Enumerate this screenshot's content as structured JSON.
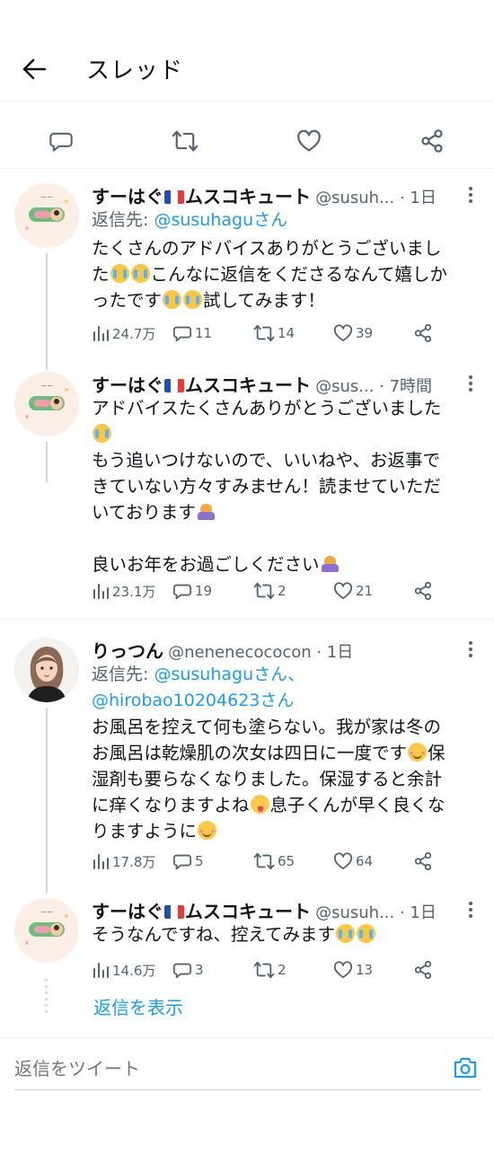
{
  "header": {
    "title": "スレッド"
  },
  "actions": [
    {
      "name": "reply-action-button",
      "icon": "reply-icon"
    },
    {
      "name": "retweet-action-button",
      "icon": "retweet-icon"
    },
    {
      "name": "like-action-button",
      "icon": "heart-icon"
    },
    {
      "name": "share-action-button",
      "icon": "share-icon"
    }
  ],
  "tweets": [
    {
      "name_before_flag": "すーはぐ",
      "name_after_flag": "ムスコキュート",
      "handle": "@susuh...",
      "time": "1日",
      "reply_prefix": "返信先: ",
      "reply_targets": [
        "@susuhaguさん"
      ],
      "text_parts": [
        "たくさんのアドバイスありがとうございまし\nた",
        "こんなに返信をくださるなんて嬉しか\nったです",
        "試してみます！"
      ],
      "metrics": {
        "views": "24.7万",
        "replies": "11",
        "retweets": "14",
        "likes": "39"
      }
    },
    {
      "name_before_flag": "すーはぐ",
      "name_after_flag": "ムスコキュート",
      "handle": "@sus...",
      "time": "7時間",
      "text_parts": [
        "アドバイスたくさんありがとうございました\n",
        "\nもう追いつけないので、いいねや、お返事で\nきていない方々すみません！読ませていただ\nいております",
        "\n\n良いお年をお過ごしください",
        ""
      ],
      "metrics": {
        "views": "23.1万",
        "replies": "19",
        "retweets": "2",
        "likes": "21"
      }
    },
    {
      "name": "りっつん",
      "handle": "@nenenecococon",
      "time": "1日",
      "reply_prefix": "返信先: ",
      "reply_targets": [
        "@susuhaguさん、",
        "@hirobao10204623さん"
      ],
      "text_parts": [
        "お風呂を控えて何も塗らない。我が家は冬の\nお風呂は乾燥肌の次女は四日に一度です",
        "保\n湿剤も要らなくなりました。保湿すると余計\nに痒くなりますよね",
        "息子くんが早く良くな\nりますように",
        ""
      ],
      "metrics": {
        "views": "17.8万",
        "replies": "5",
        "retweets": "65",
        "likes": "64"
      }
    },
    {
      "name_before_flag": "すーはぐ",
      "name_after_flag": "ムスコキュート",
      "handle": "@susuh...",
      "time": "1日",
      "text_parts": [
        "そうなんですね、控えてみます",
        "",
        ""
      ],
      "metrics": {
        "views": "14.6万",
        "replies": "3",
        "retweets": "2",
        "likes": "13"
      }
    }
  ],
  "show_replies": "返信を表示",
  "composer": {
    "placeholder": "返信をツイート"
  },
  "colors": {
    "accent": "#1d9bf0",
    "muted": "#536471",
    "text": "#0f1419",
    "line": "#cfd9de"
  }
}
